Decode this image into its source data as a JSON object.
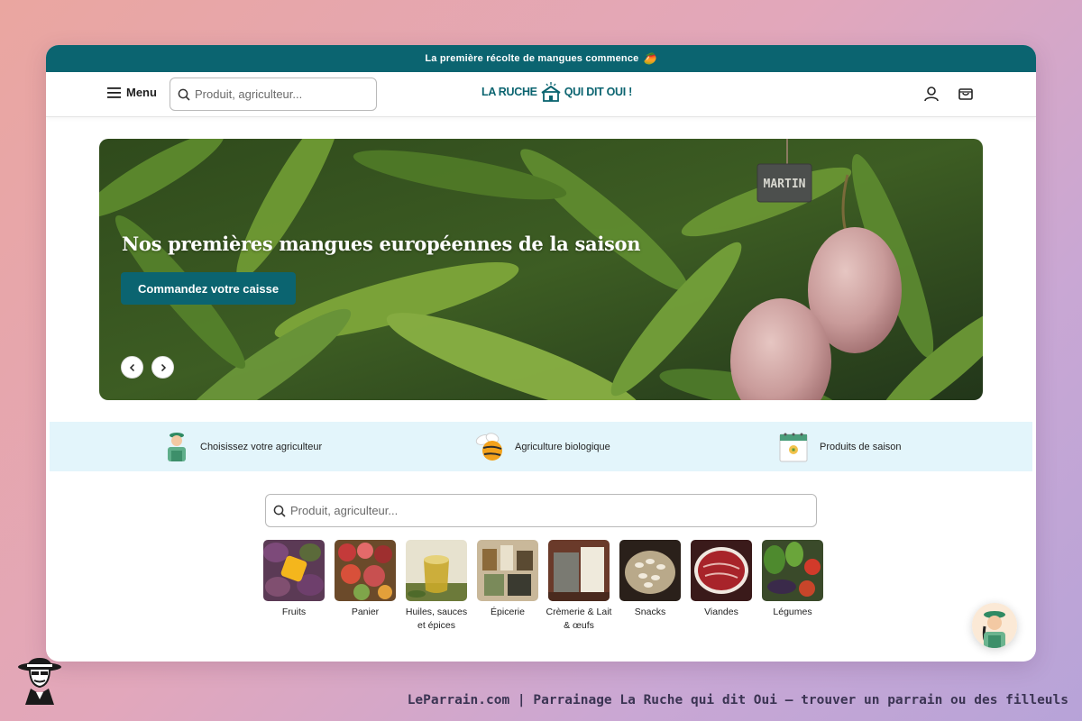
{
  "announcement": {
    "text": "La première récolte de mangues commence",
    "emoji": "🥭"
  },
  "header": {
    "menu_label": "Menu",
    "search_placeholder": "Produit, agriculteur...",
    "logo_left": "LA RUCHE",
    "logo_right": "QUI DIT OUI !"
  },
  "hero": {
    "title": "Nos premières mangues européennes de la saison",
    "cta_label": "Commandez votre caisse",
    "sign_text": "MARTIN"
  },
  "features": [
    {
      "label": "Choisissez votre agriculteur",
      "icon": "farmer-icon"
    },
    {
      "label": "Agriculture biologique",
      "icon": "bee-icon"
    },
    {
      "label": "Produits de saison",
      "icon": "calendar-icon"
    }
  ],
  "search": {
    "placeholder": "Produit, agriculteur..."
  },
  "categories": [
    {
      "label": "Fruits"
    },
    {
      "label": "Panier"
    },
    {
      "label": "Huiles, sauces et épices"
    },
    {
      "label": "Épicerie"
    },
    {
      "label": "Crèmerie & Lait & œufs"
    },
    {
      "label": "Snacks"
    },
    {
      "label": "Viandes"
    },
    {
      "label": "Légumes"
    }
  ],
  "footer": {
    "text": "LeParrain.com | Parrainage La Ruche qui dit Oui — trouver un parrain ou des filleuls"
  },
  "colors": {
    "brand": "#0b6470",
    "feature_band": "#e3f5fb"
  }
}
